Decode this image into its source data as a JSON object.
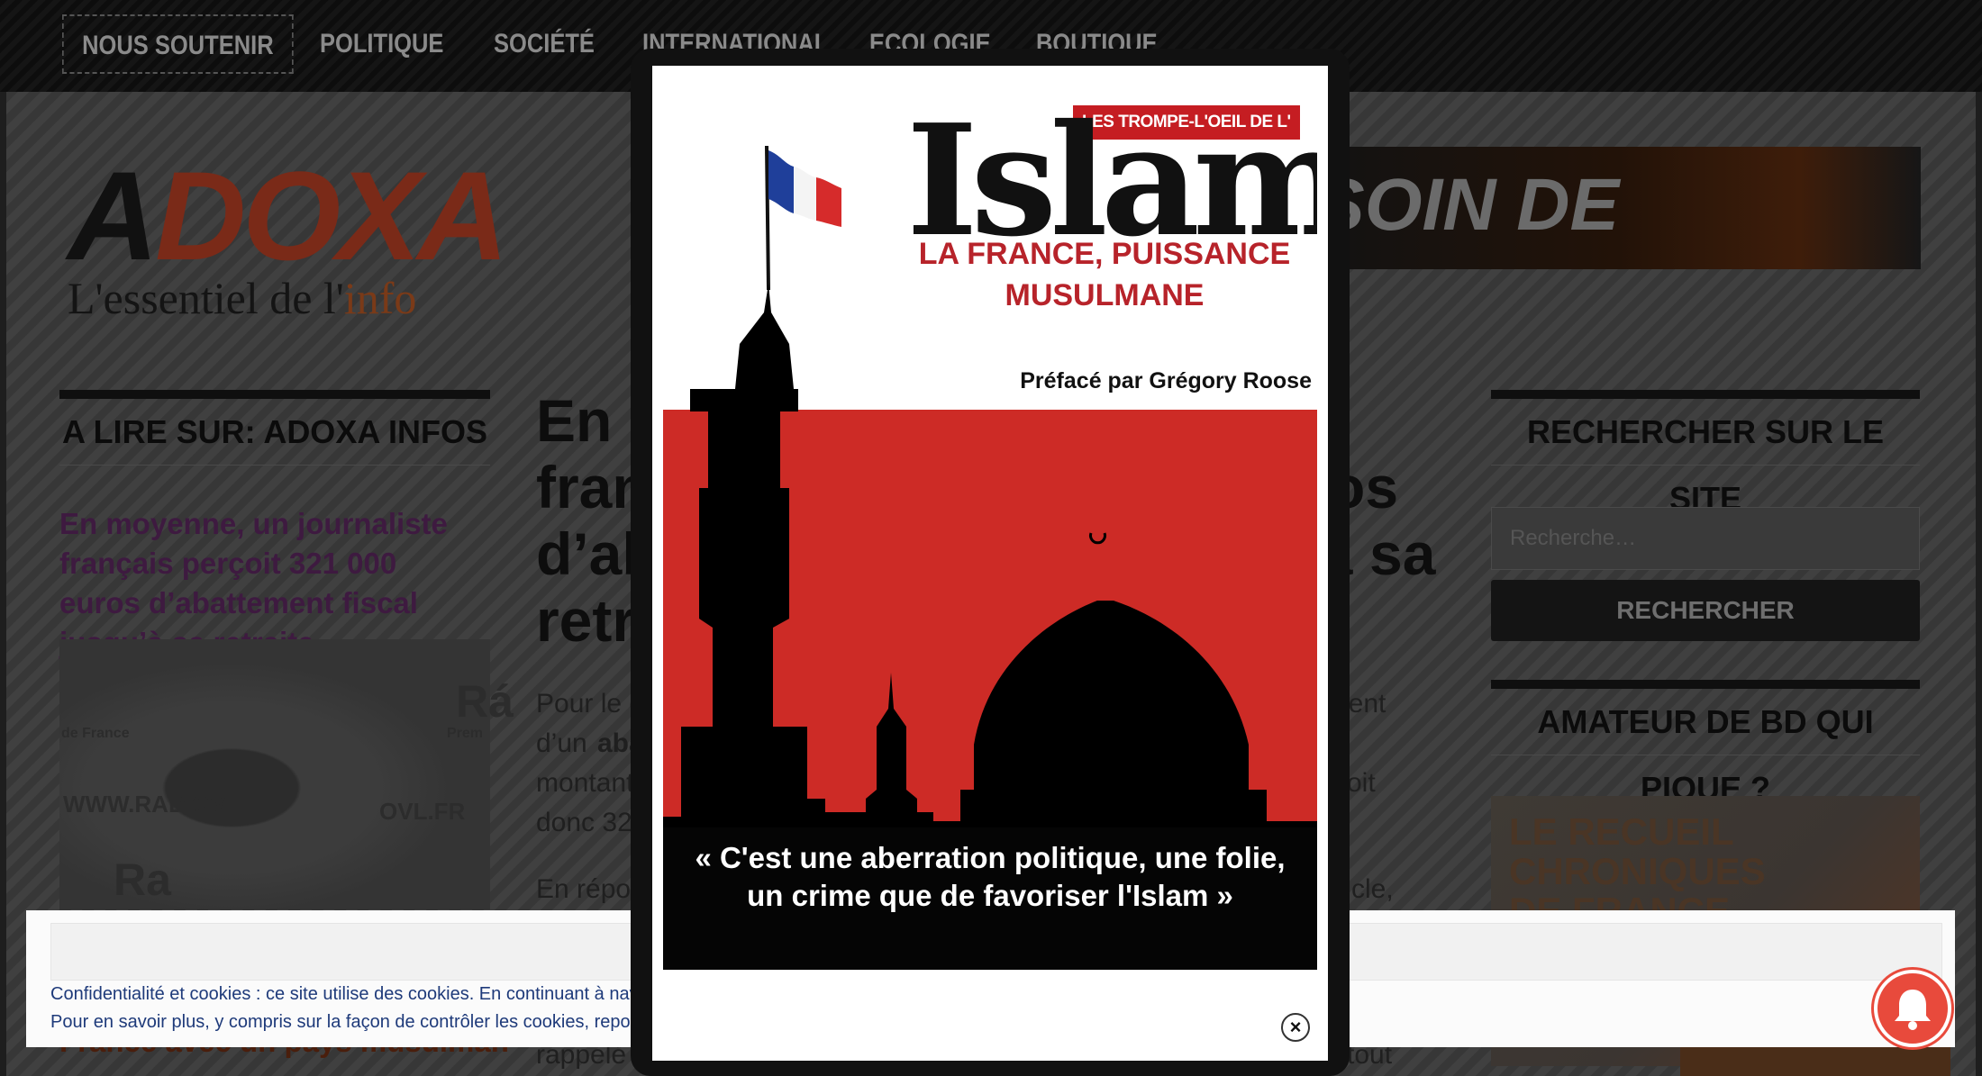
{
  "nav": {
    "items": [
      {
        "label": "NOUS SOUTENIR"
      },
      {
        "label": "POLITIQUE"
      },
      {
        "label": "SOCIÉTÉ"
      },
      {
        "label": "INTERNATIONAL"
      },
      {
        "label": "ECOLOGIE"
      },
      {
        "label": "BOUTIQUE"
      }
    ]
  },
  "logo": {
    "first_letter": "A",
    "rest": "DOXA",
    "tagline": "L'essentiel de l'",
    "tagline_accent": "info"
  },
  "banner": {
    "text": "SOIN DE"
  },
  "sidebar_left": {
    "title": "A LIRE SUR: ADOXA INFOS",
    "article_link": "En moyenne, un journaliste français perçoit 321 000 euros d’abattement fiscal jusqu’à sa retraite",
    "thumb_texts": [
      "WWW.RADIOVL.",
      "OVL.FR",
      "Ra",
      "Rá",
      "de France",
      "Prem"
    ],
    "bottom_link": "France avec un pays musulman"
  },
  "main": {
    "title_fragments": [
      "En m",
      "fran",
      "d’ab",
      "retr",
      "os",
      "à sa"
    ],
    "body_fragments": [
      "Pour le c",
      "cient",
      "d’un ",
      "abat",
      "montant",
      "oit",
      "donc 321",
      "En répon",
      "rticle,",
      "rappelé",
      "tout"
    ]
  },
  "sidebar_right": {
    "search_title": "RECHERCHER SUR LE SITE",
    "search_placeholder": "Recherche…",
    "search_button": "RECHERCHER",
    "bd_title": "AMATEUR DE BD QUI PIQUE ?",
    "bd_image_text": "LE RECUEIL\nCHRONIQUES\nDE FRANCE"
  },
  "cookie": {
    "line1": "Confidentialité et cookies : ce site utilise des cookies. En continuant à naviguer sur ce site",
    "line2": "Pour en savoir plus, y compris sur la façon de contrôler les cookies, reportez-vous à ce qui"
  },
  "modal": {
    "tag": "LES TROMPE-L'OEIL DE L'",
    "title": "Islam",
    "subtitle_line1": "LA FRANCE, PUISSANCE",
    "subtitle_line2": "MUSULMANE",
    "preface": "Préfacé par Grégory Roose",
    "quote_line1": "« C'est une aberration politique, une folie,",
    "quote_line2": "un crime que de favoriser l'Islam »",
    "close_glyph": "×"
  },
  "colors": {
    "cover_red": "#cd2b26",
    "tag_red": "#c51d22",
    "subtitle_red": "#b7232a",
    "bell": "#e84a3c",
    "cookie_text": "#1e3a7a"
  }
}
